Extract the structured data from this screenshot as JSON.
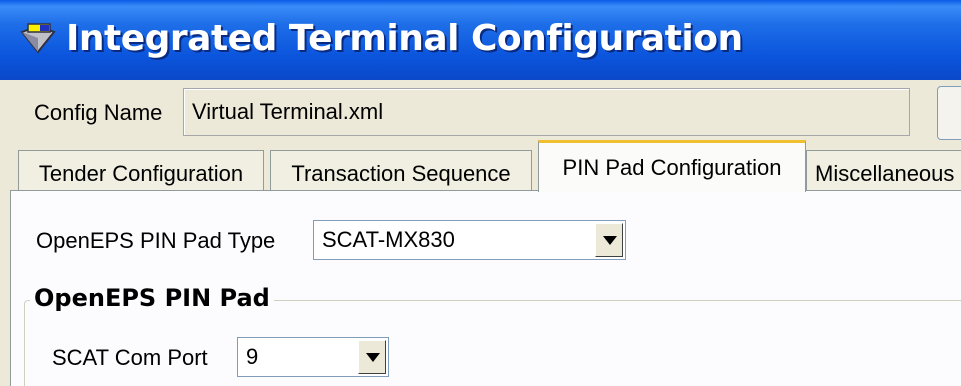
{
  "window": {
    "title": "Integrated Terminal Configuration",
    "icon": "app-icon"
  },
  "config": {
    "label": "Config Name",
    "value": "Virtual Terminal.xml"
  },
  "tabs": [
    {
      "label": "Tender Configuration",
      "active": false
    },
    {
      "label": "Transaction Sequence",
      "active": false
    },
    {
      "label": "PIN Pad Configuration",
      "active": true
    },
    {
      "label": "Miscellaneous",
      "active": false
    }
  ],
  "pinpad": {
    "type_label": "OpenEPS PIN Pad Type",
    "type_value": "SCAT-MX830"
  },
  "group": {
    "title": "OpenEPS PIN Pad",
    "com_port_label": "SCAT Com Port",
    "com_port_value": "9"
  },
  "colors": {
    "titlebar": "#0b55dd",
    "active_tab_accent": "#f0c030",
    "panel": "#fcfcfe",
    "window_bg": "#ece9d8"
  }
}
